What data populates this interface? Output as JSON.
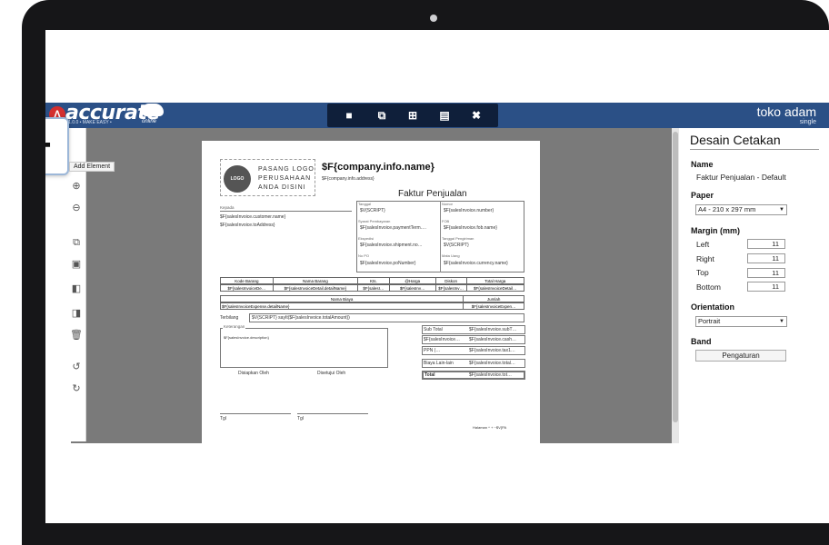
{
  "app": {
    "logo_mark": "Λ",
    "logo_text": "accurate",
    "logo_online": "online",
    "logo_tagline": "• 1.0.0 • MAKE EASY •",
    "user_name": "toko adam",
    "user_role": "single"
  },
  "toolbar": {
    "save_icon": "save-icon",
    "export_icon": "export-icon",
    "add_icon": "add-icon",
    "preview_icon": "preview-icon",
    "close_icon": "close-icon",
    "save_glyph": "■",
    "export_glyph": "⧉",
    "add_glyph": "⊞",
    "preview_glyph": "▤",
    "close_glyph": "✖"
  },
  "tools": {
    "add_element_glyph": "+",
    "add_element_tooltip": "Add Element",
    "zoom_in": "⊕",
    "zoom_out": "⊖",
    "copy": "⧉",
    "paste": "▣",
    "bring_front": "◧",
    "send_back": "◨",
    "delete": "🗑",
    "undo": "↺",
    "redo": "↻"
  },
  "document": {
    "logo_badge": "LOGO",
    "logo_placeholder": "PASANG LOGO PERUSAHAAN ANDA DISINI",
    "logo_line1": "PASANG LOGO",
    "logo_line2": "PERUSAHAAN",
    "logo_line3": "ANDA DISINI",
    "company_name": "$F{company.info.name}",
    "company_address": "$F{company.info.address}",
    "title": "Faktur Penjualan",
    "kepada_label": "Kepada",
    "customer_name": "$F{salesInvoice.customer.name}",
    "to_address": "$F{salesInvoice.toAddress}",
    "tanggal_label": "Tanggal",
    "tanggal_value": "$V{SCRIPT}",
    "nomor_label": "Nomor",
    "nomor_value": "$F{salesInvoice.number}",
    "syarat_label": "Syarat Pembayaran",
    "syarat_value": "$F{salesInvoice.paymentTerm.…",
    "fob_label": "FOB",
    "fob_value": "$F{salesInvoice.fob.name}",
    "ekspedisi_label": "Ekspedisi",
    "ekspedisi_value": "$F{salesInvoice.shipment.no…",
    "tgl_kirim_label": "Tanggal Pengiriman",
    "tgl_kirim_value": "$V{SCRIPT}",
    "po_label": "No PO",
    "po_value": "$F{salesInvoice.poNumber}",
    "mata_uang_label": "Mata Uang",
    "mata_uang_value": "$F{salesInvoice.currency.name}",
    "table_headers": [
      "Kode Barang",
      "Nama Barang",
      "Kts.",
      "@Harga",
      "Diskon",
      "Total Harga"
    ],
    "table_row": [
      "$F{salesInvoiceDe…",
      "$F{salesInvoiceDetail.detailName}",
      "$F{salesI…",
      "$F{salesInv…",
      "$F{salesInv…",
      "$F{salesInvoiceDetail…"
    ],
    "biaya_header": "Nama Biaya",
    "jumlah_header": "Jumlah",
    "biaya_row": "$F{salesInvoiceExpense.detailName}",
    "jumlah_row": "$F{salesInvoiceExpen…",
    "terbilang_label": "Terbilang",
    "terbilang_value": "$V{SCRIPT} sayIt($F{salesInvoice.totalAmount})",
    "keterangan_label": "Keterangan",
    "keterangan_value": "$F{salesInvoice.description}",
    "disiapkan_label": "Disiapkan Oleh",
    "disetujui_label": "Disetujui Oleh",
    "tgl1_label": "Tgl",
    "tgl2_label": "Tgl",
    "subtotal_label": "Sub Total",
    "subtotal_value": "$F{salesInvoice.subT…",
    "diskon_label": "$F{salesInvoice…",
    "diskon_value": "$F{salesInvoice.cash…",
    "ppn_label": "PPN (…",
    "ppn_value": "$F{salesInvoice.tax1…",
    "biaya_lain_label": "Biaya Lain-lain",
    "biaya_lain_value": "$F{salesInvoice.total…",
    "total_label": "Total",
    "total_value": "$F{salesInvoice.tot…",
    "page_footer": "Halaman ^ + ~$V{PA"
  },
  "panel": {
    "title": "Desain Cetakan",
    "name_label": "Name",
    "name_value": "Faktur Penjualan - Default",
    "paper_label": "Paper",
    "paper_value": "A4 - 210 x 297 mm",
    "margin_label": "Margin (mm)",
    "margins": [
      {
        "label": "Left",
        "value": "11"
      },
      {
        "label": "Right",
        "value": "11"
      },
      {
        "label": "Top",
        "value": "11"
      },
      {
        "label": "Bottom",
        "value": "11"
      }
    ],
    "orientation_label": "Orientation",
    "orientation_value": "Portrait",
    "band_label": "Band",
    "band_button": "Pengaturan"
  }
}
